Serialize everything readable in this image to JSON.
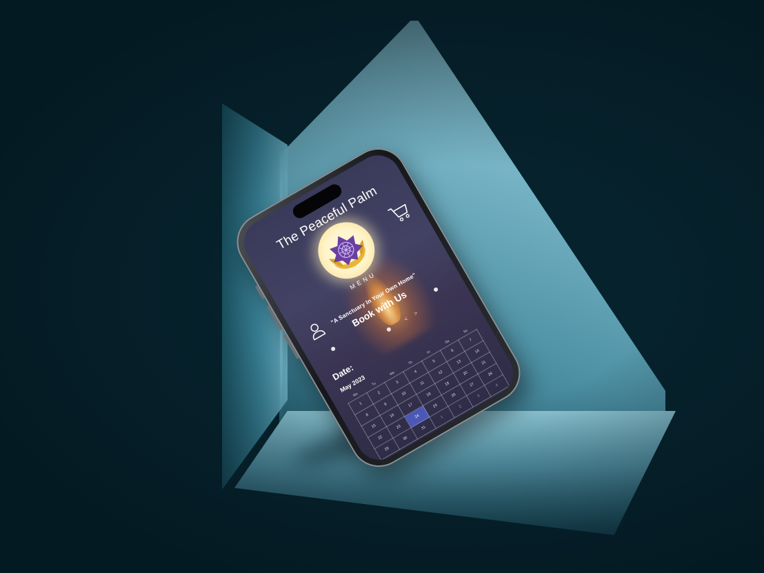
{
  "app": {
    "title": "The Peaceful Palm",
    "menu_label": "MENU",
    "tagline": "\"A Sanctuary In Your Own Home\"",
    "booking_heading": "Book with Us"
  },
  "icons": {
    "logo": "lotus-hands-logo",
    "cart": "shopping-cart-icon",
    "account": "user-icon",
    "prev": "chevron-left-icon",
    "next": "chevron-right-icon"
  },
  "booking": {
    "date_label": "Date:",
    "prev_symbol": "<",
    "next_symbol": ">",
    "calendar": {
      "month": "May 2023",
      "weekdays": [
        "Mo",
        "Tu",
        "We",
        "Th",
        "Fr",
        "Sa",
        "Su"
      ],
      "weeks": [
        [
          "1",
          "2",
          "3",
          "4",
          "5",
          "6",
          "7"
        ],
        [
          "8",
          "9",
          "10",
          "11",
          "12",
          "13",
          "14"
        ],
        [
          "15",
          "16",
          "17",
          "18",
          "19",
          "20",
          "21"
        ],
        [
          "22",
          "23",
          "24",
          "25",
          "26",
          "27",
          "28"
        ],
        [
          "29",
          "30",
          "31",
          "1",
          "2",
          "3",
          "4"
        ]
      ],
      "selected_day": "24"
    }
  },
  "colors": {
    "screen_bg": "#3b3a5c",
    "selected_day_bg": "#4b58b5",
    "logo_purple": "#6b3fa0",
    "logo_gold": "#e8b53a",
    "scene_bg": "#06222d",
    "light_teal": "#8fc7d5"
  }
}
